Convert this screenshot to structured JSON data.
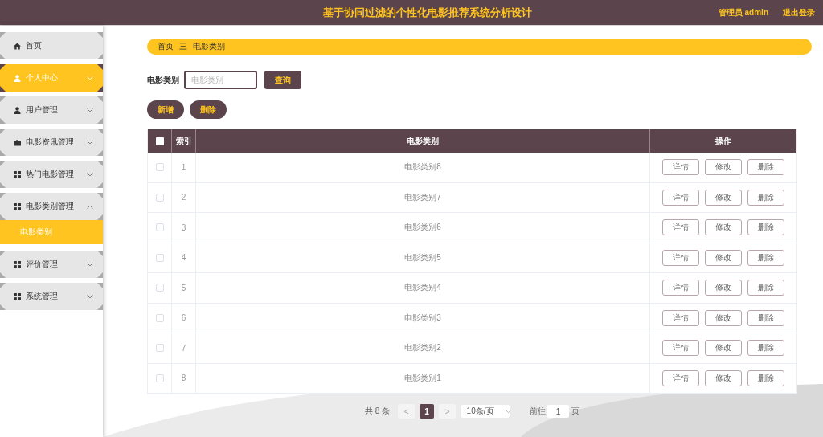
{
  "header": {
    "title": "基于协同过滤的个性化电影推荐系统分析设计",
    "user": "管理员 admin",
    "logout": "退出登录"
  },
  "sidebar": {
    "items": [
      {
        "label": "首页",
        "kind": "home",
        "selected": false
      },
      {
        "label": "个人中心",
        "kind": "profile",
        "selected": true,
        "expanded": false
      },
      {
        "label": "用户管理",
        "kind": "users",
        "selected": false,
        "expanded": false
      },
      {
        "label": "电影资讯管理",
        "kind": "news",
        "selected": false,
        "expanded": false
      },
      {
        "label": "热门电影管理",
        "kind": "module",
        "selected": false,
        "expanded": false
      },
      {
        "label": "电影类别管理",
        "kind": "module",
        "selected": false,
        "expanded": true,
        "children": [
          {
            "label": "电影类别",
            "selected": true
          }
        ]
      },
      {
        "label": "评价管理",
        "kind": "module",
        "selected": false,
        "expanded": false
      },
      {
        "label": "系统管理",
        "kind": "module",
        "selected": false,
        "expanded": false
      }
    ]
  },
  "breadcrumb": {
    "items": [
      "首页",
      "电影类别"
    ],
    "separator": "三"
  },
  "search": {
    "label": "电影类别",
    "placeholder": "电影类别",
    "button": "查询"
  },
  "actions": [
    "新增",
    "删除"
  ],
  "table": {
    "header_checkbox": {
      "checked": false
    },
    "columns": [
      "索引",
      "电影类别",
      "操作"
    ],
    "rows": [
      {
        "checked": false,
        "index": "1",
        "category": "电影类别8",
        "actions": [
          "详情",
          "修改",
          "删除"
        ]
      },
      {
        "checked": false,
        "index": "2",
        "category": "电影类别7",
        "actions": [
          "详情",
          "修改",
          "删除"
        ]
      },
      {
        "checked": false,
        "index": "3",
        "category": "电影类别6",
        "actions": [
          "详情",
          "修改",
          "删除"
        ]
      },
      {
        "checked": false,
        "index": "4",
        "category": "电影类别5",
        "actions": [
          "详情",
          "修改",
          "删除"
        ]
      },
      {
        "checked": false,
        "index": "5",
        "category": "电影类别4",
        "actions": [
          "详情",
          "修改",
          "删除"
        ]
      },
      {
        "checked": false,
        "index": "6",
        "category": "电影类别3",
        "actions": [
          "详情",
          "修改",
          "删除"
        ]
      },
      {
        "checked": false,
        "index": "7",
        "category": "电影类别2",
        "actions": [
          "详情",
          "修改",
          "删除"
        ]
      },
      {
        "checked": false,
        "index": "8",
        "category": "电影类别1",
        "actions": [
          "详情",
          "修改",
          "删除"
        ]
      }
    ]
  },
  "pagination": {
    "total": "共 8 条",
    "prev": "<",
    "pages": [
      {
        "label": "1",
        "selected": true
      }
    ],
    "next": ">",
    "page_size": "10条/页",
    "goto_label": "前往",
    "goto_value": "1",
    "goto_suffix": "页"
  }
}
